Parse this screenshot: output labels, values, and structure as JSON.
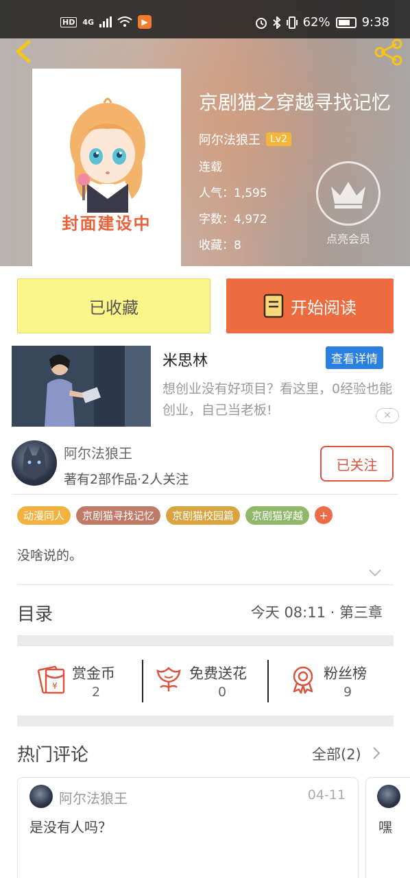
{
  "status_bar": {
    "hd": "HD",
    "signal": "4G",
    "battery": "62%",
    "time": "9:38"
  },
  "book": {
    "title": "京剧猫之穿越寻找记忆",
    "author": "阿尔法狼王",
    "level": "Lv2",
    "status": "连载",
    "popularity": "人气：1,595",
    "word_count": "字数：4,972",
    "favorites": "收藏：8",
    "cover_text": "封面建设中"
  },
  "vip": {
    "label": "点亮会员"
  },
  "actions": {
    "collected_label": "已收藏",
    "read_label": "开始阅读"
  },
  "ad": {
    "title": "米思林",
    "detail_button": "查看详情",
    "text": "想创业没有好项目？看这里，0经验也能创业，自己当老板!",
    "close": "✕"
  },
  "author": {
    "name": "阿尔法狼王",
    "meta": "著有2部作品·2人关注",
    "follow_label": "已关注"
  },
  "tags": [
    {
      "label": "动漫同人",
      "color": "#f3b240"
    },
    {
      "label": "京剧猫寻找记忆",
      "color": "#c07a68"
    },
    {
      "label": "京剧猫校园篇",
      "color": "#d9a43f"
    },
    {
      "label": "京剧猫穿越",
      "color": "#8fb86a"
    }
  ],
  "tag_add": "+",
  "description": "没啥说的。",
  "toc": {
    "label": "目录",
    "latest": "今天 08:11 · 第三章"
  },
  "stats": [
    {
      "name": "赏金币",
      "value": "2",
      "icon": "red-envelope-icon"
    },
    {
      "name": "免费送花",
      "value": "0",
      "icon": "flower-icon"
    },
    {
      "name": "粉丝榜",
      "value": "9",
      "icon": "rosette-icon"
    }
  ],
  "comments": {
    "label": "热门评论",
    "all_label": "全部(2)",
    "items": [
      {
        "user": "阿尔法狼王",
        "date": "04-11",
        "text": "是没有人吗？"
      },
      {
        "user": "",
        "date": "",
        "text": "嘿"
      }
    ]
  },
  "colors": {
    "accent_orange": "#ee6a3f",
    "collected_yellow": "#fcf58a",
    "follow_red": "#d9533d",
    "ad_blue": "#2b7fe0"
  }
}
